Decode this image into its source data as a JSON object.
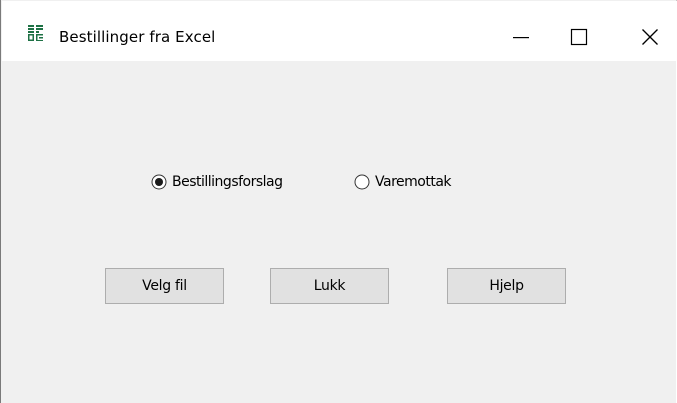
{
  "window": {
    "title": "Bestillinger fra Excel",
    "icon": "excel-grid-icon"
  },
  "caption_buttons": {
    "minimize_icon": "minimize-icon",
    "maximize_icon": "maximize-icon",
    "close_icon": "close-icon"
  },
  "options": [
    {
      "label": "Bestillingsforslag",
      "selected": true
    },
    {
      "label": "Varemottak",
      "selected": false
    }
  ],
  "buttons": {
    "select_file": "Velg fil",
    "close": "Lukk",
    "help": "Hjelp"
  },
  "colors": {
    "window_bg": "#f0f0f0",
    "titlebar_bg": "#ffffff",
    "button_bg": "#e1e1e1",
    "button_border": "#adadad",
    "icon_green": "#1e7145"
  }
}
